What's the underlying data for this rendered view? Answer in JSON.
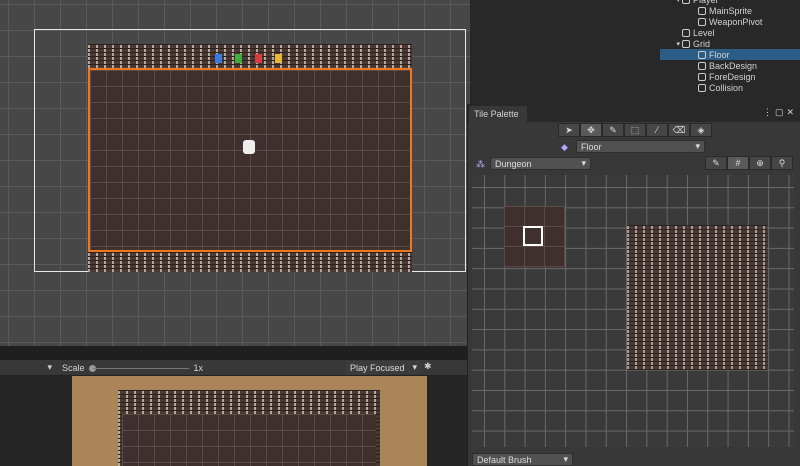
{
  "hierarchy": {
    "items": [
      {
        "label": "Player",
        "indent": 2
      },
      {
        "label": "MainSprite",
        "indent": 3
      },
      {
        "label": "WeaponPivot",
        "indent": 3
      },
      {
        "label": "Level",
        "indent": 2
      },
      {
        "label": "Grid",
        "indent": 2
      },
      {
        "label": "Floor",
        "indent": 3,
        "selected": true
      },
      {
        "label": "BackDesign",
        "indent": 3
      },
      {
        "label": "ForeDesign",
        "indent": 3
      },
      {
        "label": "Collision",
        "indent": 3
      }
    ]
  },
  "game_toolbar": {
    "scale_label": "Scale",
    "scale_value": "1x",
    "play_mode": "Play Focused"
  },
  "tile_palette": {
    "title": "Tile Palette",
    "tools": [
      "select",
      "move",
      "paint",
      "box-fill",
      "pick",
      "erase",
      "fill"
    ],
    "active_tilemap": "Floor",
    "palette": "Dungeon",
    "brush": "Default Brush"
  },
  "colors": {
    "accent": "#2c5d87",
    "border_orange": "#f0771f",
    "game_bg": "#a98557"
  }
}
